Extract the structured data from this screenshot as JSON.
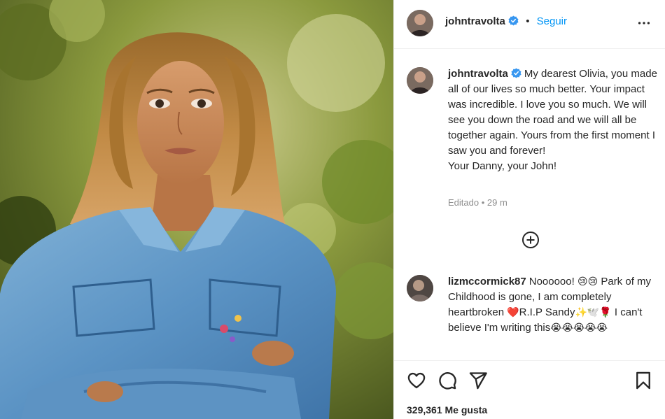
{
  "header": {
    "username": "johntravolta",
    "separator": "•",
    "follow_label": "Seguir",
    "more_icon": "more-horizontal-icon"
  },
  "caption": {
    "username": "johntravolta",
    "text": "My dearest Olivia, you made all of our lives so much better. Your impact was incredible. I love you so much. We will see you down the road and we will all be together again. Yours from the first moment I saw you and forever!",
    "signoff": "Your Danny, your John!",
    "edited": "Editado",
    "meta_sep": "•",
    "time": "29 m"
  },
  "comment": {
    "username": "lizmccormick87",
    "text_1": "Noooooo!",
    "emoji_1": "😢😢",
    "text_2": "Park of my Childhood is gone, I am completely heartbroken",
    "emoji_2": "❤️",
    "text_3": "R.I.P Sandy",
    "emoji_3": "✨🕊️🌹",
    "text_4": "I can't believe I'm writing this",
    "emoji_4": "😭😭😭😭😭"
  },
  "actions": {
    "likes": "329,361 Me gusta"
  },
  "colors": {
    "link_blue": "#0095f6",
    "verified_blue": "#3897f0",
    "text": "#262626",
    "muted": "#8e8e8e"
  }
}
